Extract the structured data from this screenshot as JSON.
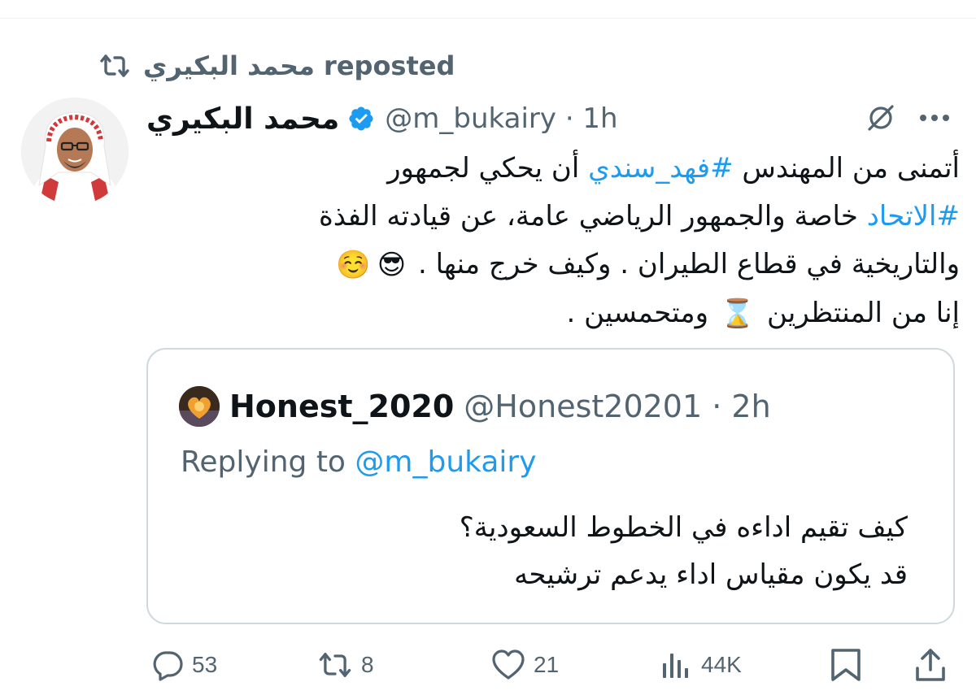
{
  "repost": {
    "text": "محمد البكيري reposted",
    "icon": "repost-icon"
  },
  "tweet": {
    "author": {
      "display_name": "محمد البكيري",
      "handle_time": "@m_bukairy · 1h",
      "verified": true
    },
    "lines": [
      {
        "before": "أتمنى من المهندس ",
        "tag": "#فهد_سندي",
        "after": " أن يحكي لجمهور"
      },
      {
        "tag": "#الاتحاد",
        "after": " خاصة والجمهور الرياضي عامة، عن قيادته الفذة"
      },
      {
        "text": "والتاريخية في قطاع الطيران . وكيف خرج منها .",
        "emojis": [
          "😎",
          "☺️"
        ]
      },
      {
        "before": "إنا من المنتظرين",
        "emoji": "⌛",
        "after": "ومتحمسين ."
      }
    ]
  },
  "quote": {
    "display_name": "Honest_2020",
    "handle_time": "@Honest20201 · 2h",
    "replying_prefix": "Replying to",
    "replying_mention": "@m_bukairy",
    "lines": [
      "كيف تقيم اداءه في الخطوط السعودية؟",
      "قد يكون مقياس اداء يدعم ترشيحه"
    ]
  },
  "actions": {
    "replies": "53",
    "reposts": "8",
    "likes": "21",
    "views": "44K"
  },
  "colors": {
    "link": "#1d9bf0",
    "muted": "#536471",
    "text": "#0f1419",
    "border": "#cfd9de",
    "verified": "#1d9bf0"
  }
}
